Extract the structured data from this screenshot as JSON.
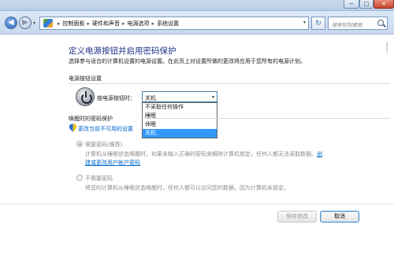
{
  "window": {
    "minimize": "−",
    "maximize": "□",
    "close": "✕"
  },
  "nav": {
    "back_glyph": "◀",
    "forward_glyph": "▶",
    "dropdown_glyph": "▾"
  },
  "address": {
    "breadcrumbs": [
      "控制面板",
      "硬件和声音",
      "电源选项",
      "系统设置"
    ],
    "separator": "▸",
    "dropdown_glyph": "▾"
  },
  "refresh_glyph": "↻",
  "search": {
    "placeholder": "搜索控制面板"
  },
  "page": {
    "title": "定义电源按钮并启用密码保护",
    "subtitle": "选择参与适合的计算机设置的电源设置。在此页上对设置所做的更改将应用于您所有的电源计划。",
    "power_section": "电源按钮设置",
    "power_label": "按电源按钮时：",
    "power_select": {
      "value": "关机",
      "arrow": "▾",
      "options": [
        "不采取任何操作",
        "睡眠",
        "休眠",
        "关机"
      ],
      "selected_index": 3
    },
    "password_section": "唤醒时的密码保护",
    "shield_link": "更改当前不可用的设置",
    "option1": {
      "title": "需要密码(推荐)",
      "desc1": "计算机从睡眠状态唤醒时，如果未输入正确的密码来解除计算机锁定，任何人都无法读取数据。",
      "desc1_link": "创",
      "desc2_link": "建或更改用户帐户密码"
    },
    "option2": {
      "title": "不需要密码",
      "desc": "将您的计算机从睡眠状态唤醒时，任何人都可以访问您的数据，因为计算机未锁定。"
    }
  },
  "buttons": {
    "save": "保存修改",
    "cancel": "取消"
  }
}
